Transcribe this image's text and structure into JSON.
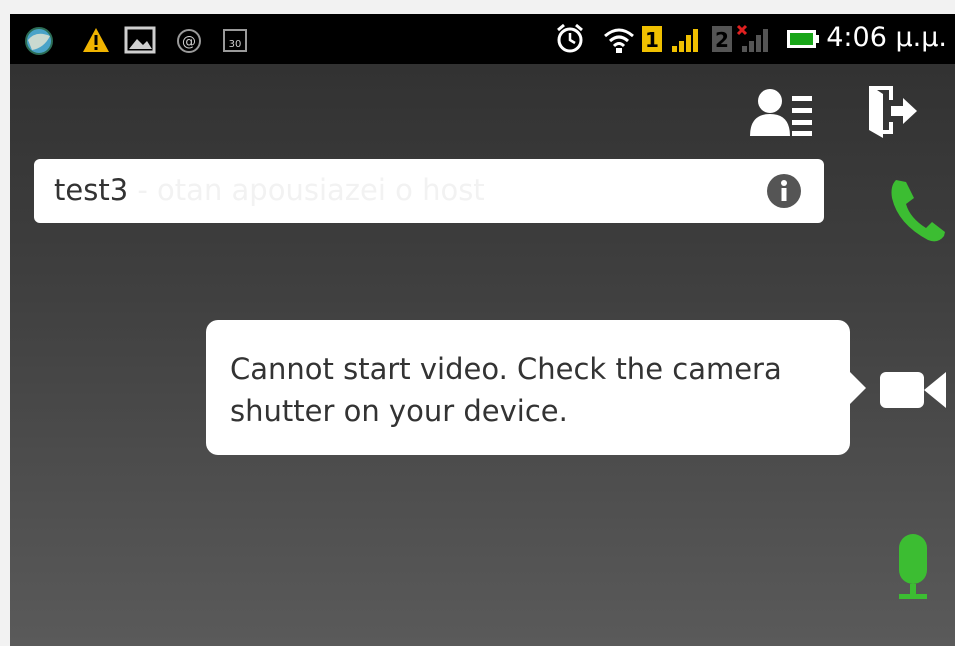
{
  "status_bar": {
    "time": "4:06 μ.μ.",
    "icons": [
      "app-icon",
      "warning-icon",
      "gallery-icon",
      "at-icon",
      "calendar-icon",
      "alarm-icon",
      "wifi-icon",
      "sim1-signal-icon",
      "sim2-signal-icon",
      "battery-icon"
    ],
    "sim1_label": "1",
    "sim2_label": "2",
    "calendar_label": "30"
  },
  "actions": {
    "contacts_icon": "contacts-list-icon",
    "exit_icon": "exit-door-icon"
  },
  "call": {
    "name": "test3",
    "status": " - otan apousiazei o host",
    "info_icon": "info-icon"
  },
  "side_buttons": {
    "call_icon": "phone-icon",
    "video_icon": "video-camera-icon",
    "mic_icon": "microphone-icon",
    "accent_green": "#3cbd32"
  },
  "tooltip": {
    "message": "Cannot start video. Check the camera shutter on your device."
  }
}
